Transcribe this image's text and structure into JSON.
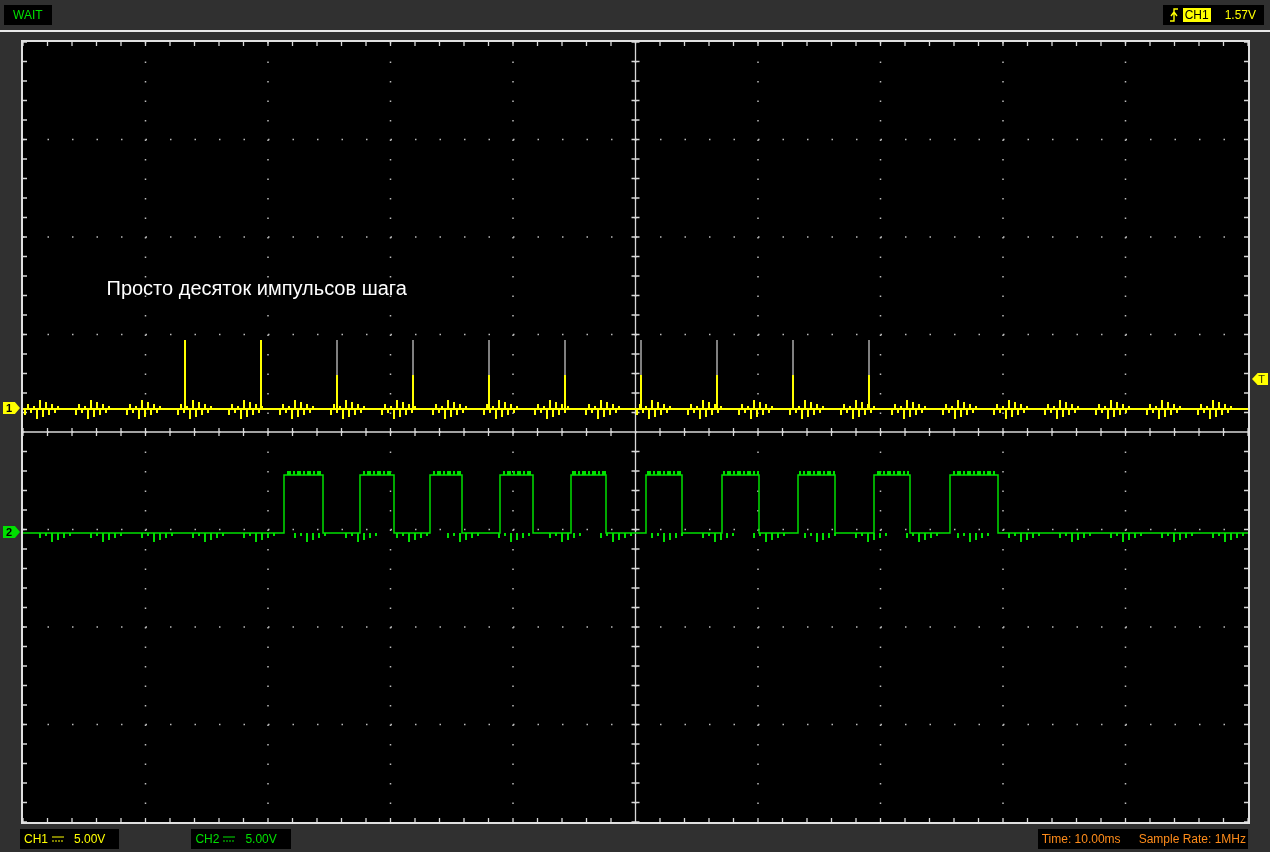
{
  "status": "WAIT",
  "trigger": {
    "channel": "CH1",
    "level_text": "1.57V"
  },
  "annotation": "Просто десяток импульсов шага",
  "markers": [
    {
      "label": "1",
      "color": "#ffff00"
    },
    {
      "label": "2",
      "color": "#00e000"
    }
  ],
  "trigger_marker": "T",
  "channels": [
    {
      "name": "CH1",
      "volts": "5.00V",
      "color": "#ffff00"
    },
    {
      "name": "CH2",
      "volts": "5.00V",
      "color": "#00e000"
    }
  ],
  "time": "Time: 10.00ms",
  "sample_rate": "Sample Rate: 1MHz"
}
